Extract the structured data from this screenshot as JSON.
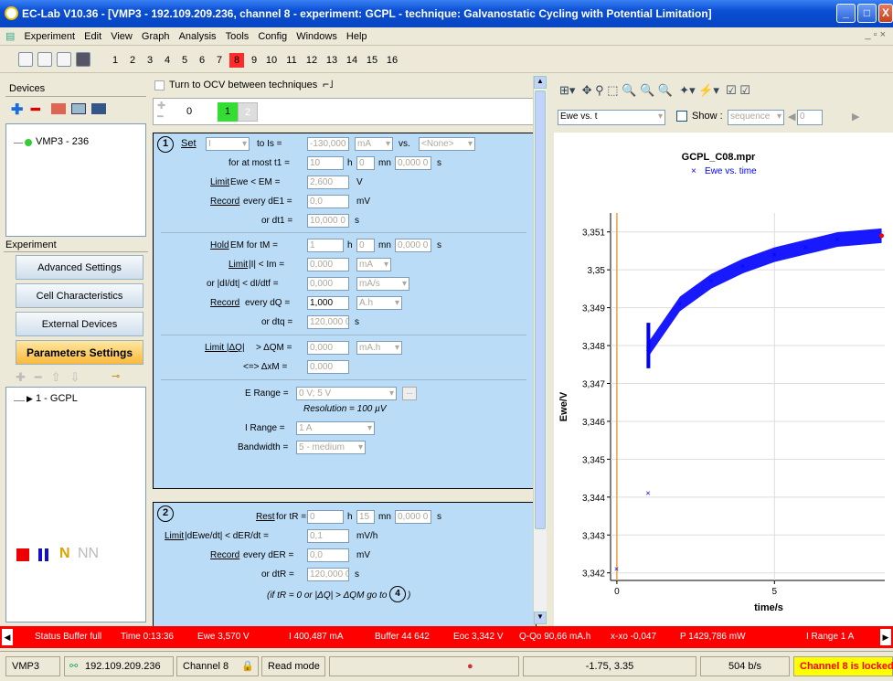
{
  "window": {
    "title": "EC-Lab V10.36 - [VMP3 - 192.109.209.236, channel 8 - experiment: GCPL - technique: Galvanostatic Cycling with Potential Limitation]"
  },
  "menu": [
    "Experiment",
    "Edit",
    "View",
    "Graph",
    "Analysis",
    "Tools",
    "Config",
    "Windows",
    "Help"
  ],
  "channels": [
    "1",
    "2",
    "3",
    "4",
    "5",
    "6",
    "7",
    "8",
    "9",
    "10",
    "11",
    "12",
    "13",
    "14",
    "15",
    "16"
  ],
  "active_channel": "8",
  "devices": {
    "header": "Devices",
    "item": "VMP3 - 236"
  },
  "experiment": {
    "header": "Experiment",
    "buttons": [
      "Advanced Settings",
      "Cell Characteristics",
      "External Devices",
      "Parameters Settings"
    ],
    "technique": "1 - GCPL"
  },
  "mid": {
    "ocv_label": "Turn to OCV between techniques",
    "seq_tabs": [
      "0",
      "1",
      "2"
    ]
  },
  "seq1": {
    "num": "1",
    "set": "Set",
    "set_val": "I",
    "to_is": "to  Is =",
    "is_val": "-130,000",
    "is_unit": "mA",
    "vs": "vs.",
    "vs_val": "<None>",
    "atmost": "for at most  t1 =",
    "t1_h": "10",
    "h": "h",
    "t1_mn": "0",
    "mn": "mn",
    "t1_s": "0,000 0",
    "s": "s",
    "limit": "Limit",
    "ewe_em": "Ewe  <  EM =",
    "em_val": "2,600",
    "v": "V",
    "record": "Record",
    "de1_lbl": "every dE1 =",
    "de1_val": "0,0",
    "mv": "mV",
    "dt1_lbl": "or  dt1 =",
    "dt1_val": "10,000 0",
    "hold": "Hold",
    "hold_lbl": "EM  for  tM =",
    "tm_h": "1",
    "tm_mn": "0",
    "tm_s": "0,000 0",
    "limit_im": "Limit",
    "im_lbl": "|I| <  Im =",
    "im_val": "0,000",
    "ma": "mA",
    "didt_lbl": "or  |dI/dt| <  dI/dtf =",
    "didt_val": "0,000",
    "mas": "mA/s",
    "record_dq": "Record",
    "dq_lbl": "every  dQ =",
    "dq_val": "1,000",
    "ah": "A.h",
    "dtq_lbl": "or  dtq =",
    "dtq_val": "120,000 0",
    "limitdq": "Limit |ΔQ|",
    "dqm_lbl": ">  ΔQM =",
    "dqm_val": "0,000",
    "mah": "mA.h",
    "dxm_lbl": "<=>  ΔxM =",
    "dxm_val": "0,000",
    "erange_lbl": "E Range =",
    "erange_val": "0 V; 5 V",
    "resolution": "Resolution = 100 µV",
    "irange_lbl": "I Range =",
    "irange_val": "1 A",
    "bw_lbl": "Bandwidth =",
    "bw_val": "5 - medium"
  },
  "seq2": {
    "num": "2",
    "rest": "Rest",
    "tr_lbl": "for  tR =",
    "tr_h": "0",
    "tr_mn": "15",
    "tr_s": "0,000 0",
    "limit": "Limit",
    "der_lbl": "|dEwe/dt|  <  dER/dt =",
    "der_val": "0,1",
    "mvh": "mV/h",
    "record": "Record",
    "der2_lbl": "every  dER =",
    "der2_val": "0,0",
    "mv": "mV",
    "dtr_lbl": "or  dtR =",
    "dtr_val": "120,000 0",
    "note": "(if tR = 0 or |ΔQ| > ΔQM  go to",
    "goto": "4"
  },
  "graph": {
    "select": "Ewe vs. t",
    "show": "Show :",
    "sequence": "sequence",
    "seqnum": "0"
  },
  "chart_data": {
    "type": "scatter",
    "title": "GCPL_C08.mpr",
    "legend": "Ewe vs. time",
    "xlabel": "time/s",
    "ylabel": "Ewe/V",
    "xlim": [
      -0.2,
      8.5
    ],
    "ylim": [
      3.3418,
      3.3515
    ],
    "x_ticks": [
      "0",
      "5"
    ],
    "y_ticks": [
      "3,342",
      "3,343",
      "3,344",
      "3,345",
      "3,346",
      "3,347",
      "3,348",
      "3,349",
      "3,35",
      "3,351"
    ],
    "points": [
      [
        0,
        3.3421
      ],
      [
        1,
        3.3441
      ],
      [
        1.0,
        3.3479
      ],
      [
        2,
        3.3491
      ],
      [
        3,
        3.3497
      ],
      [
        4,
        3.3501
      ],
      [
        5,
        3.3504
      ],
      [
        6,
        3.3506
      ],
      [
        7,
        3.3508
      ],
      [
        8.4,
        3.3509
      ]
    ],
    "series_color": "#0000ff"
  },
  "status": {
    "items": [
      "Status  Buffer full",
      "Time  0:13:36",
      "Ewe  3,570 V",
      "I  400,487 mA",
      "Buffer  44 642",
      "Eoc  3,342 V",
      "Q-Qo  90,66 mA.h",
      "x-xo  -0,047",
      "P  1429,786 mW",
      "I Range  1 A"
    ]
  },
  "statusbar": {
    "device": "VMP3",
    "ip": "192.109.209.236",
    "channel": "Channel 8",
    "mode": "Read mode",
    "coords": "-1.75, 3.35",
    "rate": "504 b/s",
    "lock": "Channel 8 is locked"
  },
  "colors": {
    "accent": "#0a4ed4",
    "status_red": "#ff0000",
    "active_seq": "#33dd33",
    "panel_bg": "#bbdcf6",
    "lock_bg": "#ffff00"
  }
}
